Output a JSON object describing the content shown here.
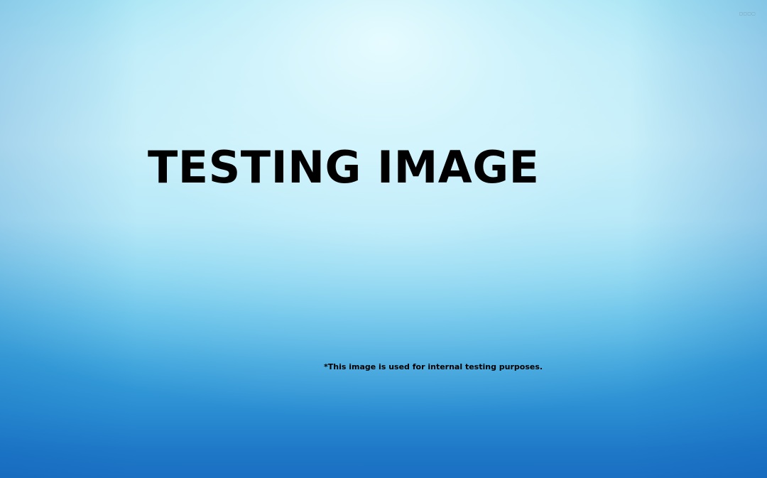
{
  "screen": {
    "title": "TESTING IMAGE",
    "footnote": "*This image is used for internal testing purposes.",
    "corner_mark": "▢▢▢▢"
  },
  "colors": {
    "text": "#000000",
    "background_top": "#bcebf8",
    "background_bottom": "#1a6fc2"
  }
}
